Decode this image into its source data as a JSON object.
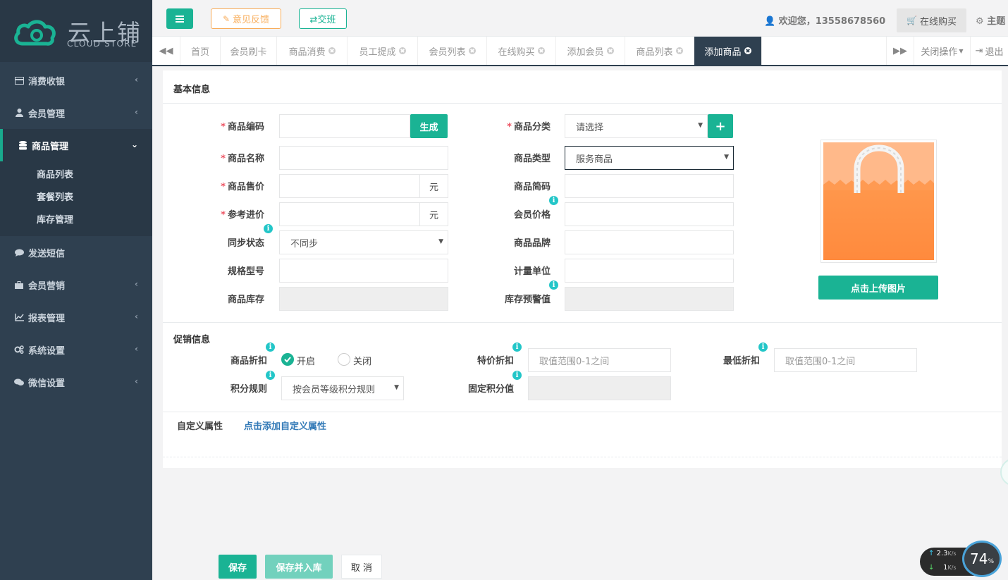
{
  "logo": {
    "name_cn": "云上铺",
    "name_en": "CLOUD STORE"
  },
  "sidebar": {
    "items": [
      {
        "label": "消费收银",
        "icon": "card-icon"
      },
      {
        "label": "会员管理",
        "icon": "user-icon"
      },
      {
        "label": "商品管理",
        "icon": "database-icon"
      },
      {
        "label": "发送短信",
        "icon": "comment-icon"
      },
      {
        "label": "会员营销",
        "icon": "briefcase-icon"
      },
      {
        "label": "报表管理",
        "icon": "line-chart-icon"
      },
      {
        "label": "系统设置",
        "icon": "gears-icon"
      },
      {
        "label": "微信设置",
        "icon": "comments-icon"
      }
    ],
    "sub_items": [
      "商品列表",
      "套餐列表",
      "库存管理"
    ]
  },
  "topbar": {
    "feedback": "意见反馈",
    "shift": "⇄交班",
    "welcome": "欢迎您，13558678560",
    "buy_online": "在线购买",
    "theme": "主题"
  },
  "tabs": {
    "items": [
      "首页",
      "会员刷卡",
      "商品消费",
      "员工提成",
      "会员列表",
      "在线购买",
      "添加会员",
      "商品列表",
      "添加商品"
    ],
    "close_ops": "关闭操作",
    "logout": "退出"
  },
  "form": {
    "basic_title": "基本信息",
    "code_label": "商品编码",
    "generate_btn": "生成",
    "name_label": "商品名称",
    "price_label": "商品售价",
    "ref_price_label": "参考进价",
    "unit_yuan": "元",
    "sync_label": "同步状态",
    "sync_value": "不同步",
    "spec_label": "规格型号",
    "stock_label": "商品库存",
    "category_label": "商品分类",
    "category_value": "请选择",
    "type_label": "商品类型",
    "type_value": "服务商品",
    "short_label": "商品简码",
    "member_price_label": "会员价格",
    "brand_label": "商品品牌",
    "measure_label": "计量单位",
    "warn_label": "库存预警值",
    "upload_btn": "点击上传图片",
    "promo_title": "促销信息",
    "discount_label": "商品折扣",
    "discount_on": "开启",
    "discount_off": "关闭",
    "special_label": "特价折扣",
    "special_placeholder": "取值范围0-1之间",
    "min_label": "最低折扣",
    "min_placeholder": "取值范围0-1之间",
    "points_label": "积分规则",
    "points_value": "按会员等级积分规则",
    "fixed_points_label": "固定积分值",
    "custom_label": "自定义属性",
    "custom_link": "点击添加自定义属性"
  },
  "footer": {
    "save": "保存",
    "save_stock": "保存并入库",
    "cancel": "取 消"
  },
  "network": {
    "up": "2.3",
    "down": "1",
    "unit": "K/s",
    "percent": "74",
    "percent_sign": "%"
  },
  "colors": {
    "primary": "#1ab394",
    "sidebar": "#2f4050",
    "orange": "#f8ac59",
    "info": "#23c6c8"
  }
}
